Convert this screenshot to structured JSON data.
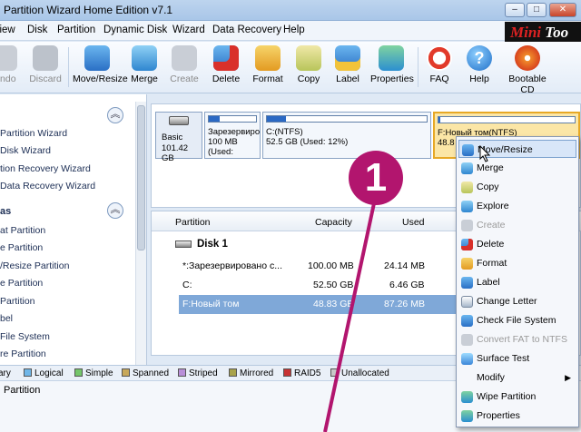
{
  "window": {
    "title": "Partition Wizard Home Edition v7.1"
  },
  "menubar": [
    "View",
    "Disk",
    "Partition",
    "Dynamic Disk",
    "Wizard",
    "Data Recovery",
    "Help"
  ],
  "logo": {
    "a": "Mini",
    "b": "Too"
  },
  "toolbar": {
    "items": [
      {
        "label": "Undo",
        "icon": "undo-icon",
        "enabled": false
      },
      {
        "label": "Discard",
        "icon": "discard-icon",
        "enabled": false
      },
      {
        "label": "Move/Resize",
        "icon": "move-resize-icon",
        "enabled": true
      },
      {
        "label": "Merge",
        "icon": "merge-icon",
        "enabled": true
      },
      {
        "label": "Create",
        "icon": "create-icon",
        "enabled": false
      },
      {
        "label": "Delete",
        "icon": "delete-icon",
        "enabled": true
      },
      {
        "label": "Format",
        "icon": "format-icon",
        "enabled": true
      },
      {
        "label": "Copy",
        "icon": "copy-icon",
        "enabled": true
      },
      {
        "label": "Label",
        "icon": "label-icon",
        "enabled": true
      },
      {
        "label": "Properties",
        "icon": "properties-icon",
        "enabled": true
      },
      {
        "label": "FAQ",
        "icon": "faq-icon",
        "enabled": true
      },
      {
        "label": "Help",
        "icon": "help-icon",
        "enabled": true
      },
      {
        "label": "Bootable CD",
        "icon": "bootable-cd-icon",
        "enabled": true
      }
    ]
  },
  "left": {
    "wizards": [
      "Partition Wizard",
      "Disk Wizard",
      "tion Recovery Wizard",
      "Data Recovery Wizard"
    ],
    "ops_head": "as",
    "ops": [
      "at Partition",
      "e Partition",
      "/Resize Partition",
      "e Partition",
      "Partition",
      "bel",
      "File System",
      "re Partition"
    ]
  },
  "diskmap": {
    "disk": {
      "name": "Basic",
      "size": "101.42 GB"
    },
    "parts": [
      {
        "title": "Зарезервиро",
        "info": "100 MB (Used:",
        "fill": 24
      },
      {
        "title": "C:(NTFS)",
        "info": "52.5 GB (Used: 12%)",
        "fill": 12
      },
      {
        "title": "F:Новый том(NTFS)",
        "info": "48.8 G",
        "fill": 1
      }
    ]
  },
  "table": {
    "headers": {
      "partition": "Partition",
      "capacity": "Capacity",
      "used": "Used"
    },
    "disk_label": "Disk 1",
    "rows": [
      {
        "name": "*:Зарезервировано с...",
        "capacity": "100.00 MB",
        "used": "24.14 MB"
      },
      {
        "name": "C:",
        "capacity": "52.50 GB",
        "used": "6.46 GB"
      },
      {
        "name": "F:Новый том",
        "capacity": "48.83 GB",
        "used": "87.26 MB"
      }
    ]
  },
  "legend": [
    {
      "label": "ary",
      "color": "#2b66c4"
    },
    {
      "label": "Logical",
      "color": "#6fb6e8"
    },
    {
      "label": "Simple",
      "color": "#74c66a"
    },
    {
      "label": "Spanned",
      "color": "#c8a85a"
    },
    {
      "label": "Striped",
      "color": "#b98fd8"
    },
    {
      "label": "Mirrored",
      "color": "#a8a24a"
    },
    {
      "label": "RAID5",
      "color": "#c83232"
    },
    {
      "label": "Unallocated",
      "color": "#c8c8c8"
    }
  ],
  "status": {
    "text": "Partition"
  },
  "context_menu": {
    "items": [
      {
        "label": "Move/Resize",
        "icon": "move-resize-icon",
        "enabled": true
      },
      {
        "label": "Merge",
        "icon": "merge-icon",
        "enabled": true
      },
      {
        "label": "Copy",
        "icon": "copy-icon",
        "enabled": true
      },
      {
        "label": "Explore",
        "icon": "explore-icon",
        "enabled": true
      },
      {
        "label": "Create",
        "icon": "create-icon",
        "enabled": false
      },
      {
        "label": "Delete",
        "icon": "delete-icon",
        "enabled": true
      },
      {
        "label": "Format",
        "icon": "format-icon",
        "enabled": true
      },
      {
        "label": "Label",
        "icon": "label-icon",
        "enabled": true
      },
      {
        "label": "Change Letter",
        "icon": "change-letter-icon",
        "enabled": true
      },
      {
        "label": "Check File System",
        "icon": "check-fs-icon",
        "enabled": true
      },
      {
        "label": "Convert FAT to NTFS",
        "icon": "convert-icon",
        "enabled": false
      },
      {
        "label": "Surface Test",
        "icon": "surface-test-icon",
        "enabled": true
      },
      {
        "label": "Modify",
        "icon": "",
        "enabled": true
      },
      {
        "label": "Wipe Partition",
        "icon": "wipe-icon",
        "enabled": true
      },
      {
        "label": "Properties",
        "icon": "properties-icon",
        "enabled": true
      }
    ]
  },
  "callout": {
    "number": "1",
    "color": "#b2156e"
  }
}
